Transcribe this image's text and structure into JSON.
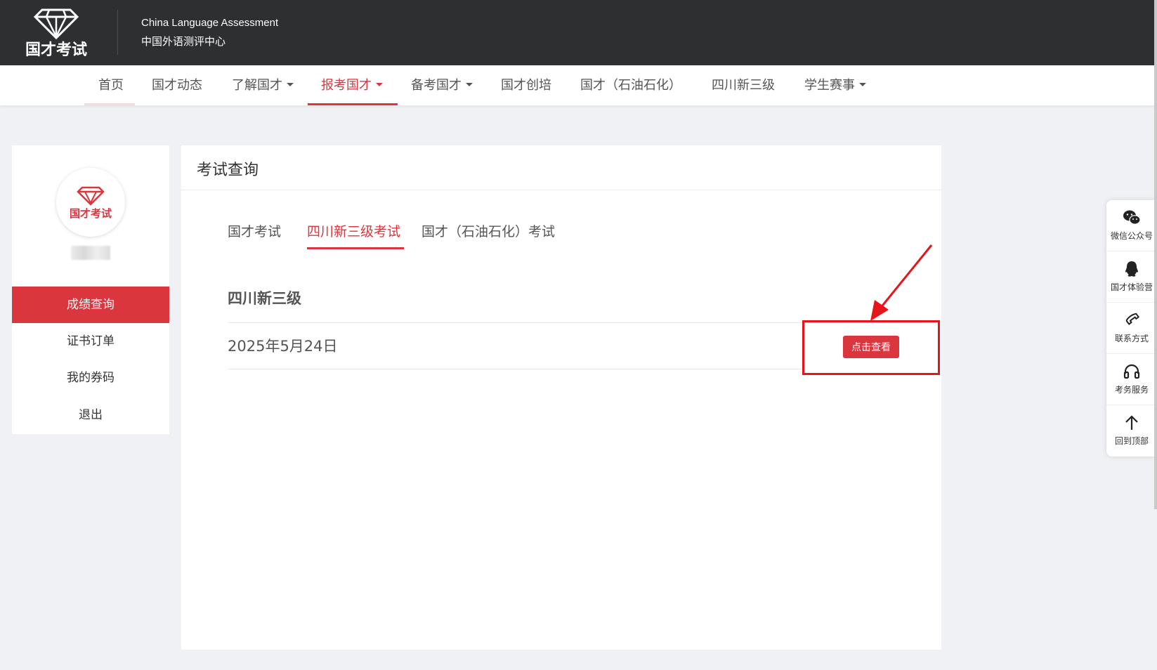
{
  "header": {
    "org_en": "China Language Assessment",
    "org_cn": "中国外语测评中心",
    "logo_text": "国才考试"
  },
  "nav": {
    "items": [
      {
        "label": "首页"
      },
      {
        "label": "国才动态"
      },
      {
        "label": "了解国才"
      },
      {
        "label": "报考国才"
      },
      {
        "label": "备考国才"
      },
      {
        "label": "国才创培"
      },
      {
        "label": "国才（石油石化）"
      },
      {
        "label": "四川新三级"
      },
      {
        "label": "学生赛事"
      }
    ],
    "active": "报考国才"
  },
  "sidebar": {
    "avatar_logo_text": "国才考试",
    "items": [
      {
        "label": "成绩查询"
      },
      {
        "label": "证书订单"
      },
      {
        "label": "我的券码"
      },
      {
        "label": "退出"
      }
    ],
    "active": "成绩查询"
  },
  "main": {
    "title": "考试查询",
    "tabs": [
      {
        "label": "国才考试"
      },
      {
        "label": "四川新三级考试"
      },
      {
        "label": "国才（石油石化）考试"
      }
    ],
    "active_tab": "四川新三级考试",
    "section_title": "四川新三级",
    "rows": [
      {
        "date": "2025年5月24日",
        "action_label": "点击查看"
      }
    ]
  },
  "float_bar": {
    "items": [
      {
        "label": "微信公众号",
        "icon": "wechat-icon"
      },
      {
        "label": "国才体验营",
        "icon": "qq-icon"
      },
      {
        "label": "联系方式",
        "icon": "phone-icon"
      },
      {
        "label": "考务服务",
        "icon": "headset-icon"
      },
      {
        "label": "回到顶部",
        "icon": "arrow-up-icon"
      }
    ]
  },
  "colors": {
    "accent": "#d9363e",
    "header_bg": "#2d2f31",
    "page_bg": "#f0f1f4",
    "annotation_red": "#e8141b"
  }
}
